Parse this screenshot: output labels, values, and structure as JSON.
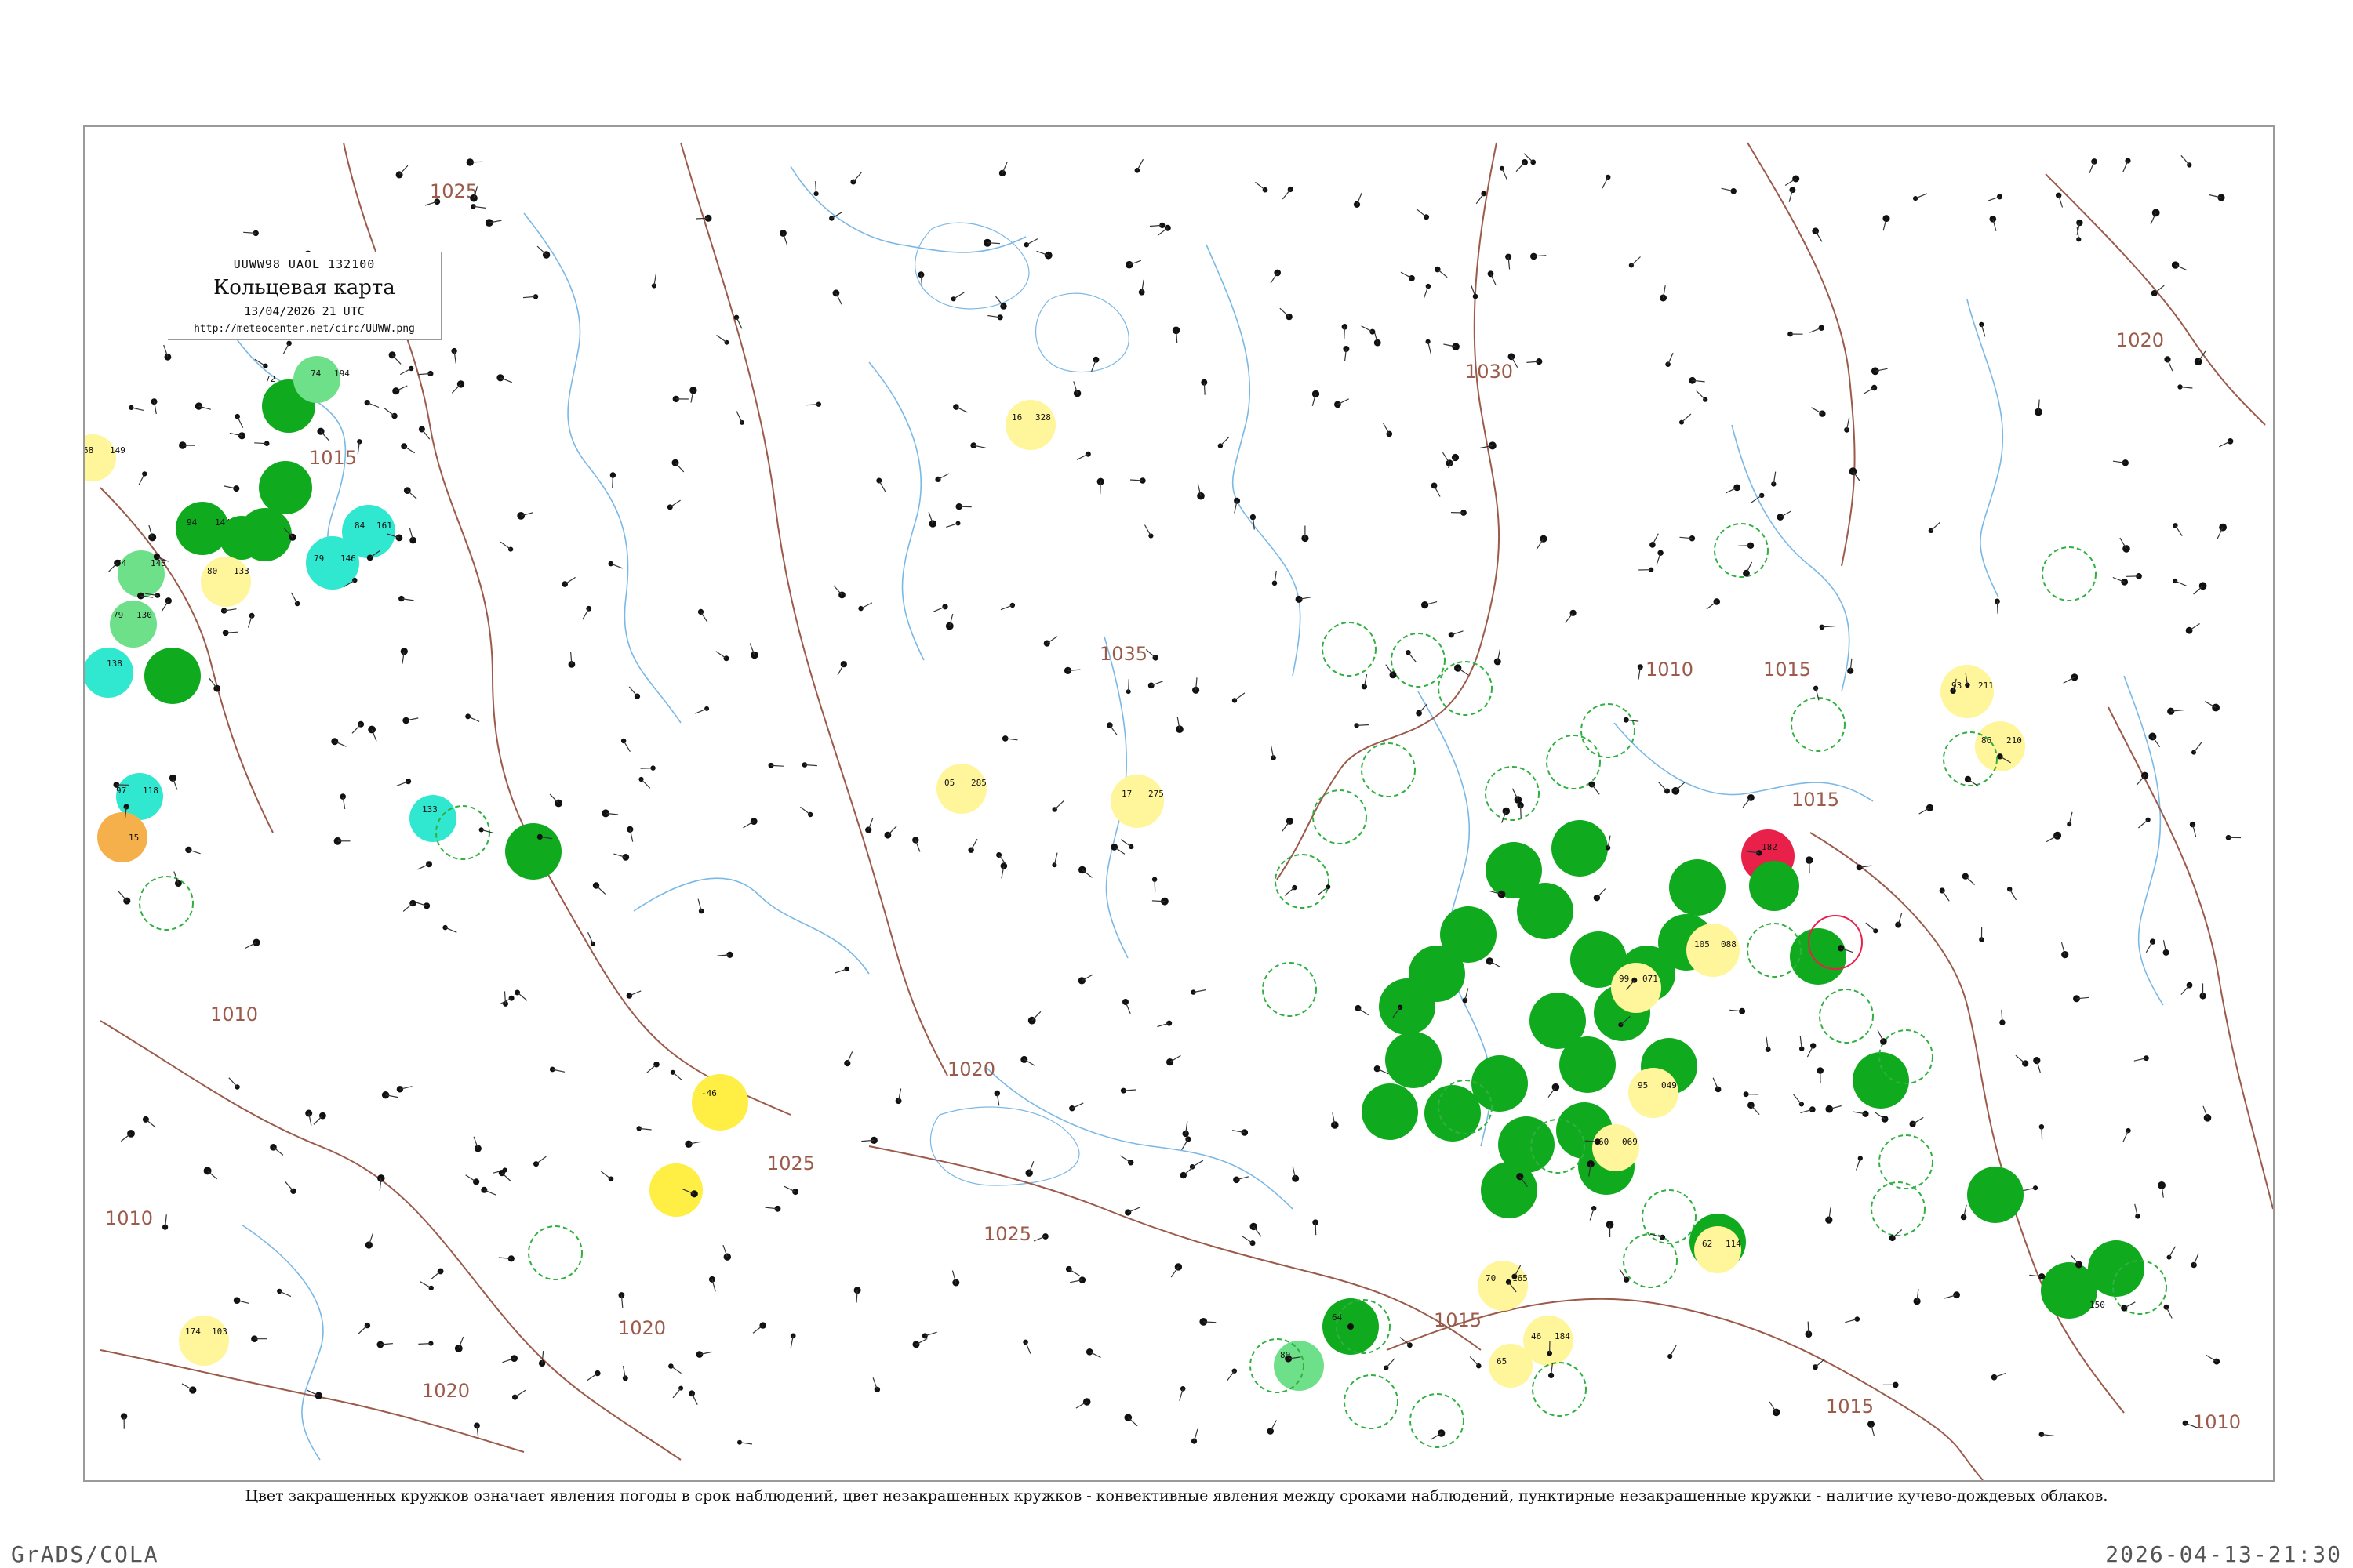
{
  "header": {
    "code": "UUWW98  UAOL  132100",
    "title": "Кольцевая карта",
    "datetime": "13/04/2026 21 UTC",
    "url": "http://meteocenter.net/circ/UUWW.png"
  },
  "caption": "Цвет закрашенных кружков означает явления погоды в срок наблюдений, цвет незакрашенных кружков - конвективные явления между сроками наблюдений, пунктирные незакрашенные кружки - наличие кучево-дождевых облаков.",
  "credits": {
    "left": "GrADS/COLA",
    "right": "2026-04-13-21:30"
  },
  "colors": {
    "green": "#0faa1e",
    "light_green": "#6fe08a",
    "cyan": "#30e8d0",
    "yellow": "#ffee44",
    "pale_yellow": "#fff59a",
    "orange": "#f5b04c",
    "red": "#e8204a",
    "isobar": "#9b5a4a",
    "river": "#7ab8e6",
    "dashed_ring": "#30b040"
  },
  "isobars": [
    {
      "label": "1025"
    },
    {
      "label": "1015"
    },
    {
      "label": "1010"
    },
    {
      "label": "1010"
    },
    {
      "label": "1025"
    },
    {
      "label": "1025"
    },
    {
      "label": "1020"
    },
    {
      "label": "1020"
    },
    {
      "label": "1030"
    },
    {
      "label": "1035"
    },
    {
      "label": "1020"
    },
    {
      "label": "1015"
    },
    {
      "label": "1015"
    },
    {
      "label": "1015"
    },
    {
      "label": "1010"
    },
    {
      "label": "1015"
    },
    {
      "label": "1020"
    },
    {
      "label": "1010"
    }
  ],
  "stations": [
    {
      "t": "72",
      "p": "194",
      "c": "green"
    },
    {
      "t": "74",
      "p": "194",
      "c": "light_green"
    },
    {
      "t": "68",
      "p": "149",
      "c": "pale_yellow"
    },
    {
      "t": "94",
      "p": "144",
      "c": "green"
    },
    {
      "t": "84",
      "p": "161",
      "c": "cyan"
    },
    {
      "t": "79",
      "p": "146",
      "c": "cyan"
    },
    {
      "t": "80",
      "p": "133",
      "c": "pale_yellow"
    },
    {
      "t": "74",
      "p": "143",
      "c": "light_green"
    },
    {
      "t": "79",
      "p": "130",
      "c": "light_green"
    },
    {
      "t": "138",
      "p": "",
      "c": "cyan"
    },
    {
      "t": "97",
      "p": "118",
      "c": "cyan"
    },
    {
      "t": "15",
      "p": "",
      "c": "orange"
    },
    {
      "t": "133",
      "p": "",
      "c": "cyan"
    },
    {
      "t": "",
      "p": "",
      "c": "green"
    },
    {
      "t": "-46",
      "p": "",
      "c": "yellow"
    },
    {
      "t": "",
      "p": "",
      "c": "yellow"
    },
    {
      "t": "16",
      "p": "328",
      "c": "pale_yellow"
    },
    {
      "t": "05",
      "p": "285",
      "c": "pale_yellow"
    },
    {
      "t": "17",
      "p": "275",
      "c": "pale_yellow"
    },
    {
      "t": "182",
      "p": "",
      "c": "red"
    },
    {
      "t": "93",
      "p": "211",
      "c": "pale_yellow"
    },
    {
      "t": "86",
      "p": "210",
      "c": "pale_yellow"
    },
    {
      "t": "105",
      "p": "088",
      "c": "pale_yellow"
    },
    {
      "t": "99",
      "p": "071",
      "c": "pale_yellow"
    },
    {
      "t": "95",
      "p": "049",
      "c": "pale_yellow"
    },
    {
      "t": "60",
      "p": "069",
      "c": "pale_yellow"
    },
    {
      "t": "62",
      "p": "114",
      "c": "pale_yellow"
    },
    {
      "t": "70",
      "p": "165",
      "c": "pale_yellow"
    },
    {
      "t": "46",
      "p": "184",
      "c": "pale_yellow"
    },
    {
      "t": "65",
      "p": "",
      "c": "pale_yellow"
    },
    {
      "t": "174",
      "p": "103",
      "c": "pale_yellow"
    },
    {
      "t": "80",
      "p": "",
      "c": "light_green"
    },
    {
      "t": "64",
      "p": "",
      "c": "green"
    },
    {
      "t": "150",
      "p": "",
      "c": "green"
    }
  ]
}
